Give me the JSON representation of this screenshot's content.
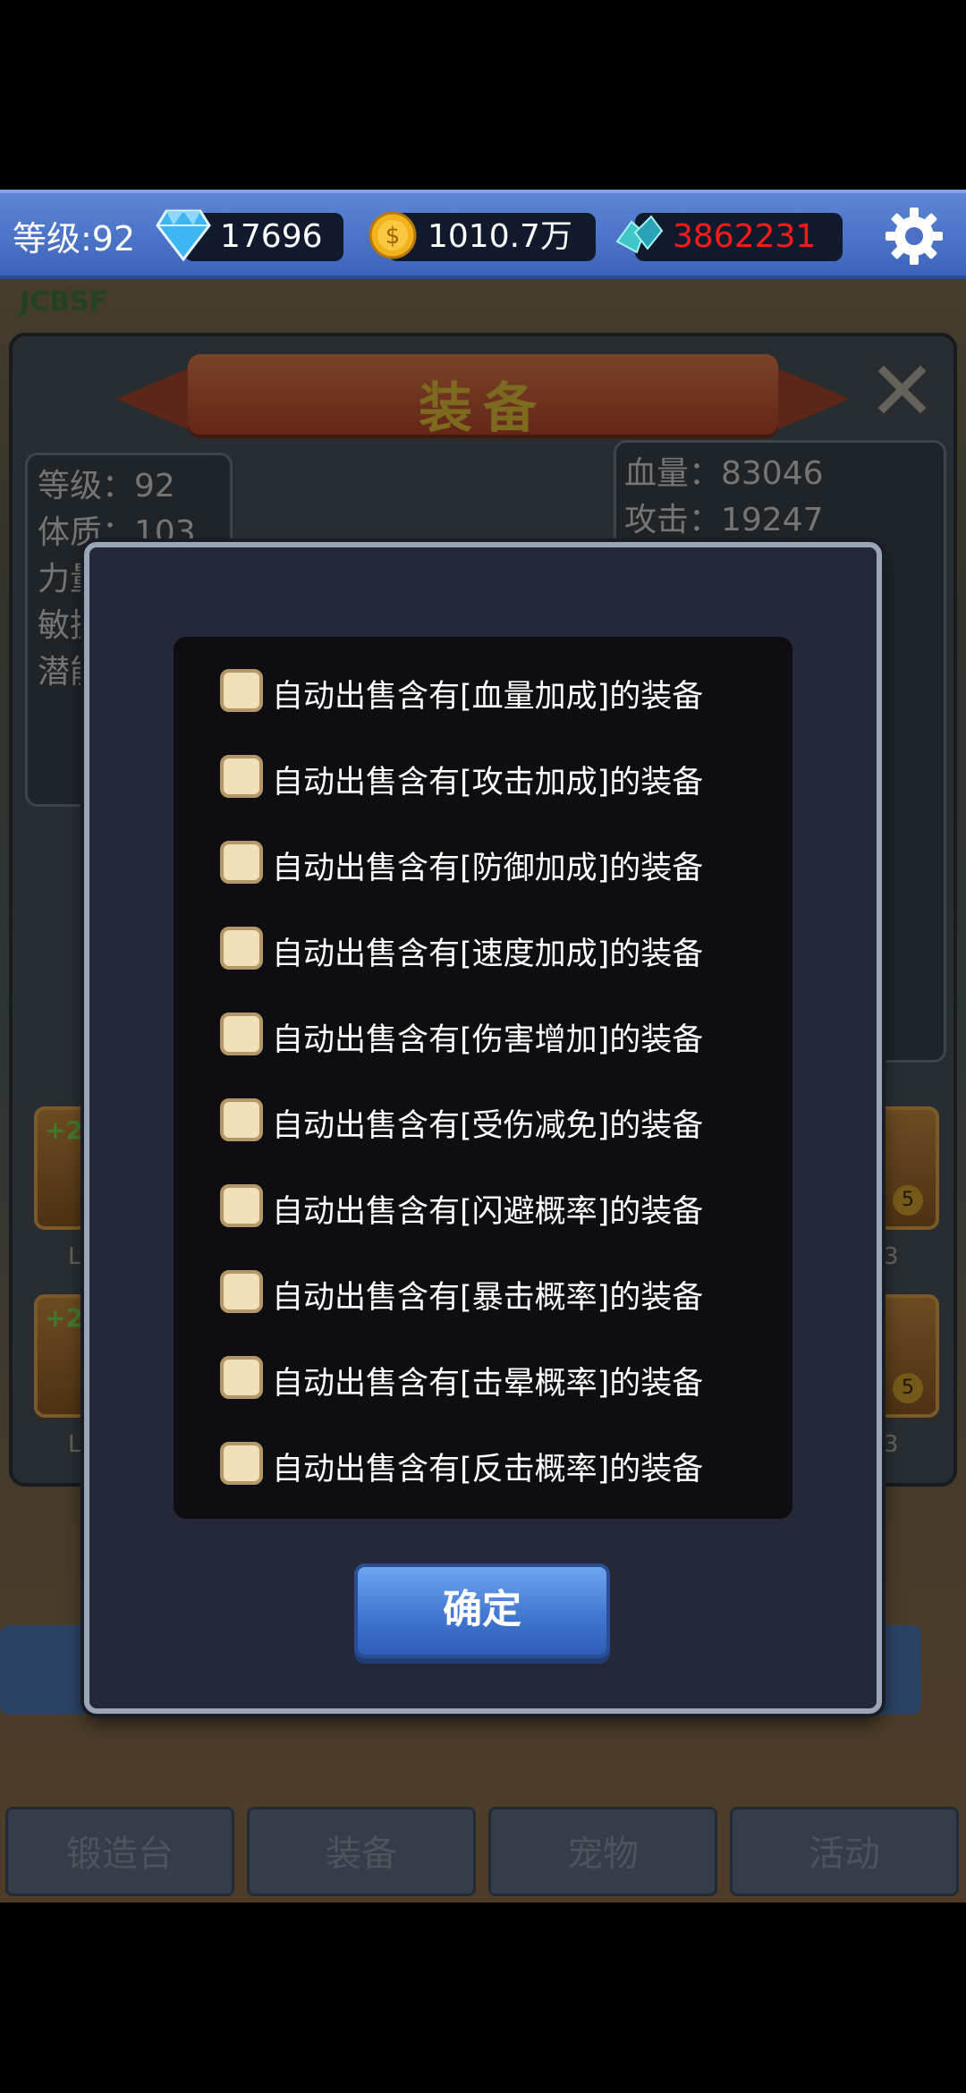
{
  "topbar": {
    "level": "等级:92",
    "gems": "17696",
    "gold": "1010.7万",
    "ore": "3862231",
    "ore_color": "#ff1a1a",
    "icons": [
      "gem-icon",
      "coin-icon",
      "ore-icon",
      "gear-icon"
    ]
  },
  "watermark": "JCBSF",
  "panel": {
    "title": "装备",
    "stats_left": [
      "等级：92",
      "体质：103",
      "力量",
      "敏捷",
      "潜能"
    ],
    "stats_right": [
      "血量：83046",
      "攻击：19247"
    ],
    "slot_plus": "+2",
    "slot_level_left": "L",
    "slot_level_right": "3",
    "star_value": "5"
  },
  "modal": {
    "options": [
      "自动出售含有[血量加成]的装备",
      "自动出售含有[攻击加成]的装备",
      "自动出售含有[防御加成]的装备",
      "自动出售含有[速度加成]的装备",
      "自动出售含有[伤害增加]的装备",
      "自动出售含有[受伤减免]的装备",
      "自动出售含有[闪避概率]的装备",
      "自动出售含有[暴击概率]的装备",
      "自动出售含有[击晕概率]的装备",
      "自动出售含有[反击概率]的装备"
    ],
    "confirm": "确定"
  },
  "tabs": [
    "锻造台",
    "装备",
    "宠物",
    "活动"
  ]
}
